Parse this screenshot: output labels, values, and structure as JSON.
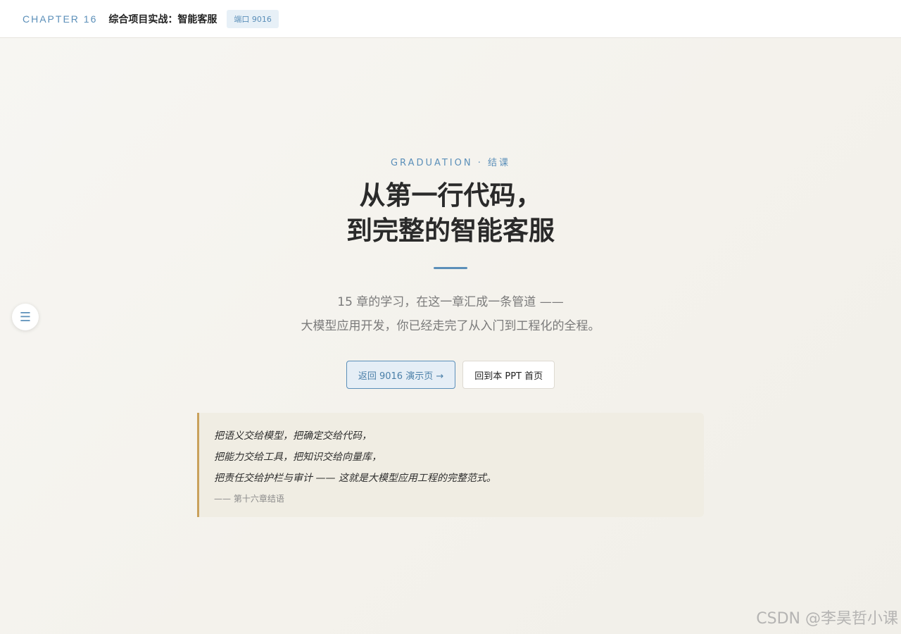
{
  "topbar": {
    "chapter": "CHAPTER 16",
    "title": "综合项目实战：智能客服",
    "port_badge": "端口 9016"
  },
  "sidebar_toggle": {
    "icon": "menu-icon",
    "glyph": "☰"
  },
  "hero": {
    "eyebrow": "GRADUATION · 结课",
    "title_lines": [
      "从第一行代码，",
      "到完整的智能客服"
    ],
    "subtitle_lines": [
      "15 章的学习，在这一章汇成一条管道 ——",
      "大模型应用开发，你已经走完了从入门到工程化的全程。"
    ],
    "buttons": {
      "primary": "返回 9016 演示页 →",
      "secondary": "回到本 PPT 首页"
    }
  },
  "quote": {
    "lines": [
      "把语义交给模型，把确定交给代码，",
      "把能力交给工具，把知识交给向量库，",
      "把责任交给护栏与审计 —— 这就是大模型应用工程的完整范式。"
    ],
    "source": "—— 第十六章结语"
  },
  "watermark": "CSDN @李昊哲小课",
  "colors": {
    "accent": "#5b8fb9",
    "quote_border": "#c9a15c"
  }
}
